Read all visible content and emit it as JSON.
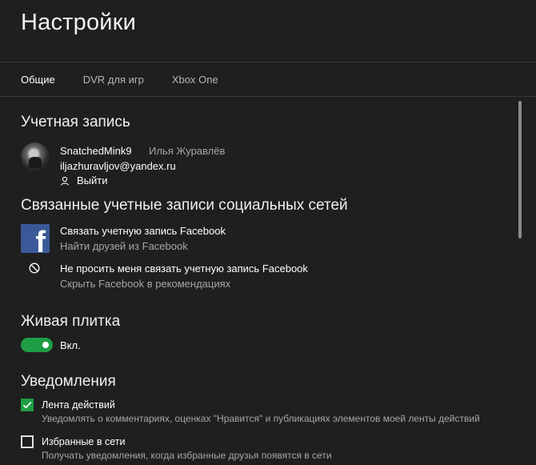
{
  "window": {
    "title": "Настройки"
  },
  "tabs": [
    {
      "label": "Общие",
      "active": true
    },
    {
      "label": "DVR для игр",
      "active": false
    },
    {
      "label": "Xbox One",
      "active": false
    }
  ],
  "account": {
    "heading": "Учетная запись",
    "gamertag": "SnatchedMink9",
    "real_name": "Илья Журавлёв",
    "email": "iljazhuravljov@yandex.ru",
    "signout_label": "Выйти"
  },
  "social": {
    "heading": "Связанные учетные записи социальных сетей",
    "facebook_link_title": "Связать учетную запись Facebook",
    "facebook_link_sub": "Найти друзей из Facebook",
    "facebook_dont_ask_title": "Не просить меня связать учетную запись Facebook",
    "facebook_dont_ask_sub": "Скрыть Facebook в рекомендациях",
    "facebook_letter": "f"
  },
  "live_tile": {
    "heading": "Живая плитка",
    "toggle_label": "Вкл.",
    "toggle_on": true
  },
  "notifications": {
    "heading": "Уведомления",
    "activity_feed_label": "Лента действий",
    "activity_feed_sub": "Уведомлять о комментариях, оценках \"Нравится\" и публикациях элементов моей ленты действий",
    "activity_feed_checked": true,
    "favorites_online_label": "Избранные в сети",
    "favorites_online_sub": "Получать уведомления, когда избранные друзья появятся в сети",
    "favorites_online_checked": false
  },
  "colors": {
    "background": "#1f1f1f",
    "accent_green": "#1e9e44",
    "facebook_blue": "#3b5998",
    "secondary_text": "#a6a6a6"
  },
  "icons": {
    "signout": "person-icon",
    "facebook": "facebook-icon",
    "block": "block-icon",
    "check": "checkmark-icon"
  }
}
